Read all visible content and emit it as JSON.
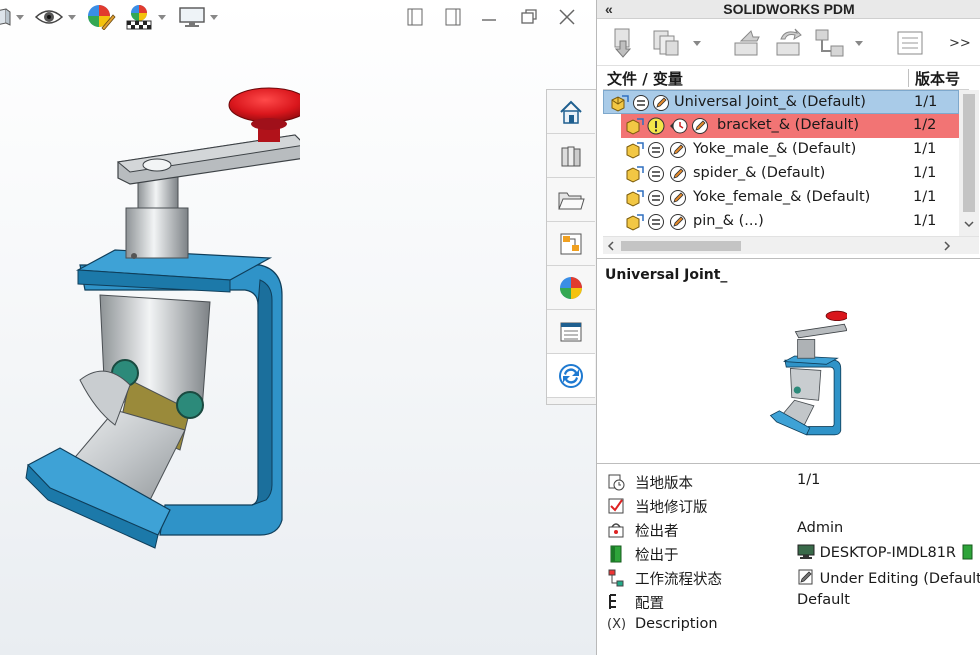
{
  "viewport": {
    "toolbar_icons": [
      "box-icon",
      "eye-icon",
      "appearance-icon",
      "scene-icon",
      "display-icon"
    ],
    "window_buttons": [
      "tile-left-icon",
      "tile-right-icon",
      "minimize-icon",
      "restore-icon",
      "close-icon"
    ]
  },
  "taskpane_tabs": [
    "home-icon",
    "library-icon",
    "folder-icon",
    "palette-icon",
    "appearance-icon",
    "properties-icon",
    "pdm-icon"
  ],
  "pdm": {
    "collapse_label": "«",
    "title": "SOLIDWORKS PDM",
    "more_label": ">>",
    "tree": {
      "col_file": "文件 / 变量",
      "col_version": "版本号",
      "rows": [
        {
          "name": "Universal Joint_&  (Default)",
          "version": "1/1"
        },
        {
          "name": "bracket_&  (Default)",
          "version": "1/2"
        },
        {
          "name": "Yoke_male_&  (Default)",
          "version": "1/1"
        },
        {
          "name": "spider_&  (Default)",
          "version": "1/1"
        },
        {
          "name": "Yoke_female_&  (Default)",
          "version": "1/1"
        },
        {
          "name": "pin_&  (...)",
          "version": "1/1"
        }
      ]
    },
    "preview_title": "Universal Joint_",
    "properties": [
      {
        "icon": "local-version-icon",
        "key": "当地版本",
        "value": "1/1"
      },
      {
        "icon": "checkbox-icon",
        "key": "当地修订版",
        "value": ""
      },
      {
        "icon": "user-icon",
        "key": "检出者",
        "value": "Admin"
      },
      {
        "icon": "checkout-icon",
        "key": "检出于",
        "value": "DESKTOP-IMDL81R"
      },
      {
        "icon": "workflow-icon",
        "key": "工作流程状态",
        "value": "Under Editing (Default ..."
      },
      {
        "icon": "config-icon",
        "key": "配置",
        "value": "Default"
      },
      {
        "icon": "variable-icon",
        "key": "Description",
        "value": ""
      }
    ],
    "variable_symbol": "(X)"
  },
  "colors": {
    "selected_row": "#a9cbe8",
    "warning_row": "#f27474",
    "model_blue": "#2f93c8",
    "knob_red": "#d9161c"
  }
}
